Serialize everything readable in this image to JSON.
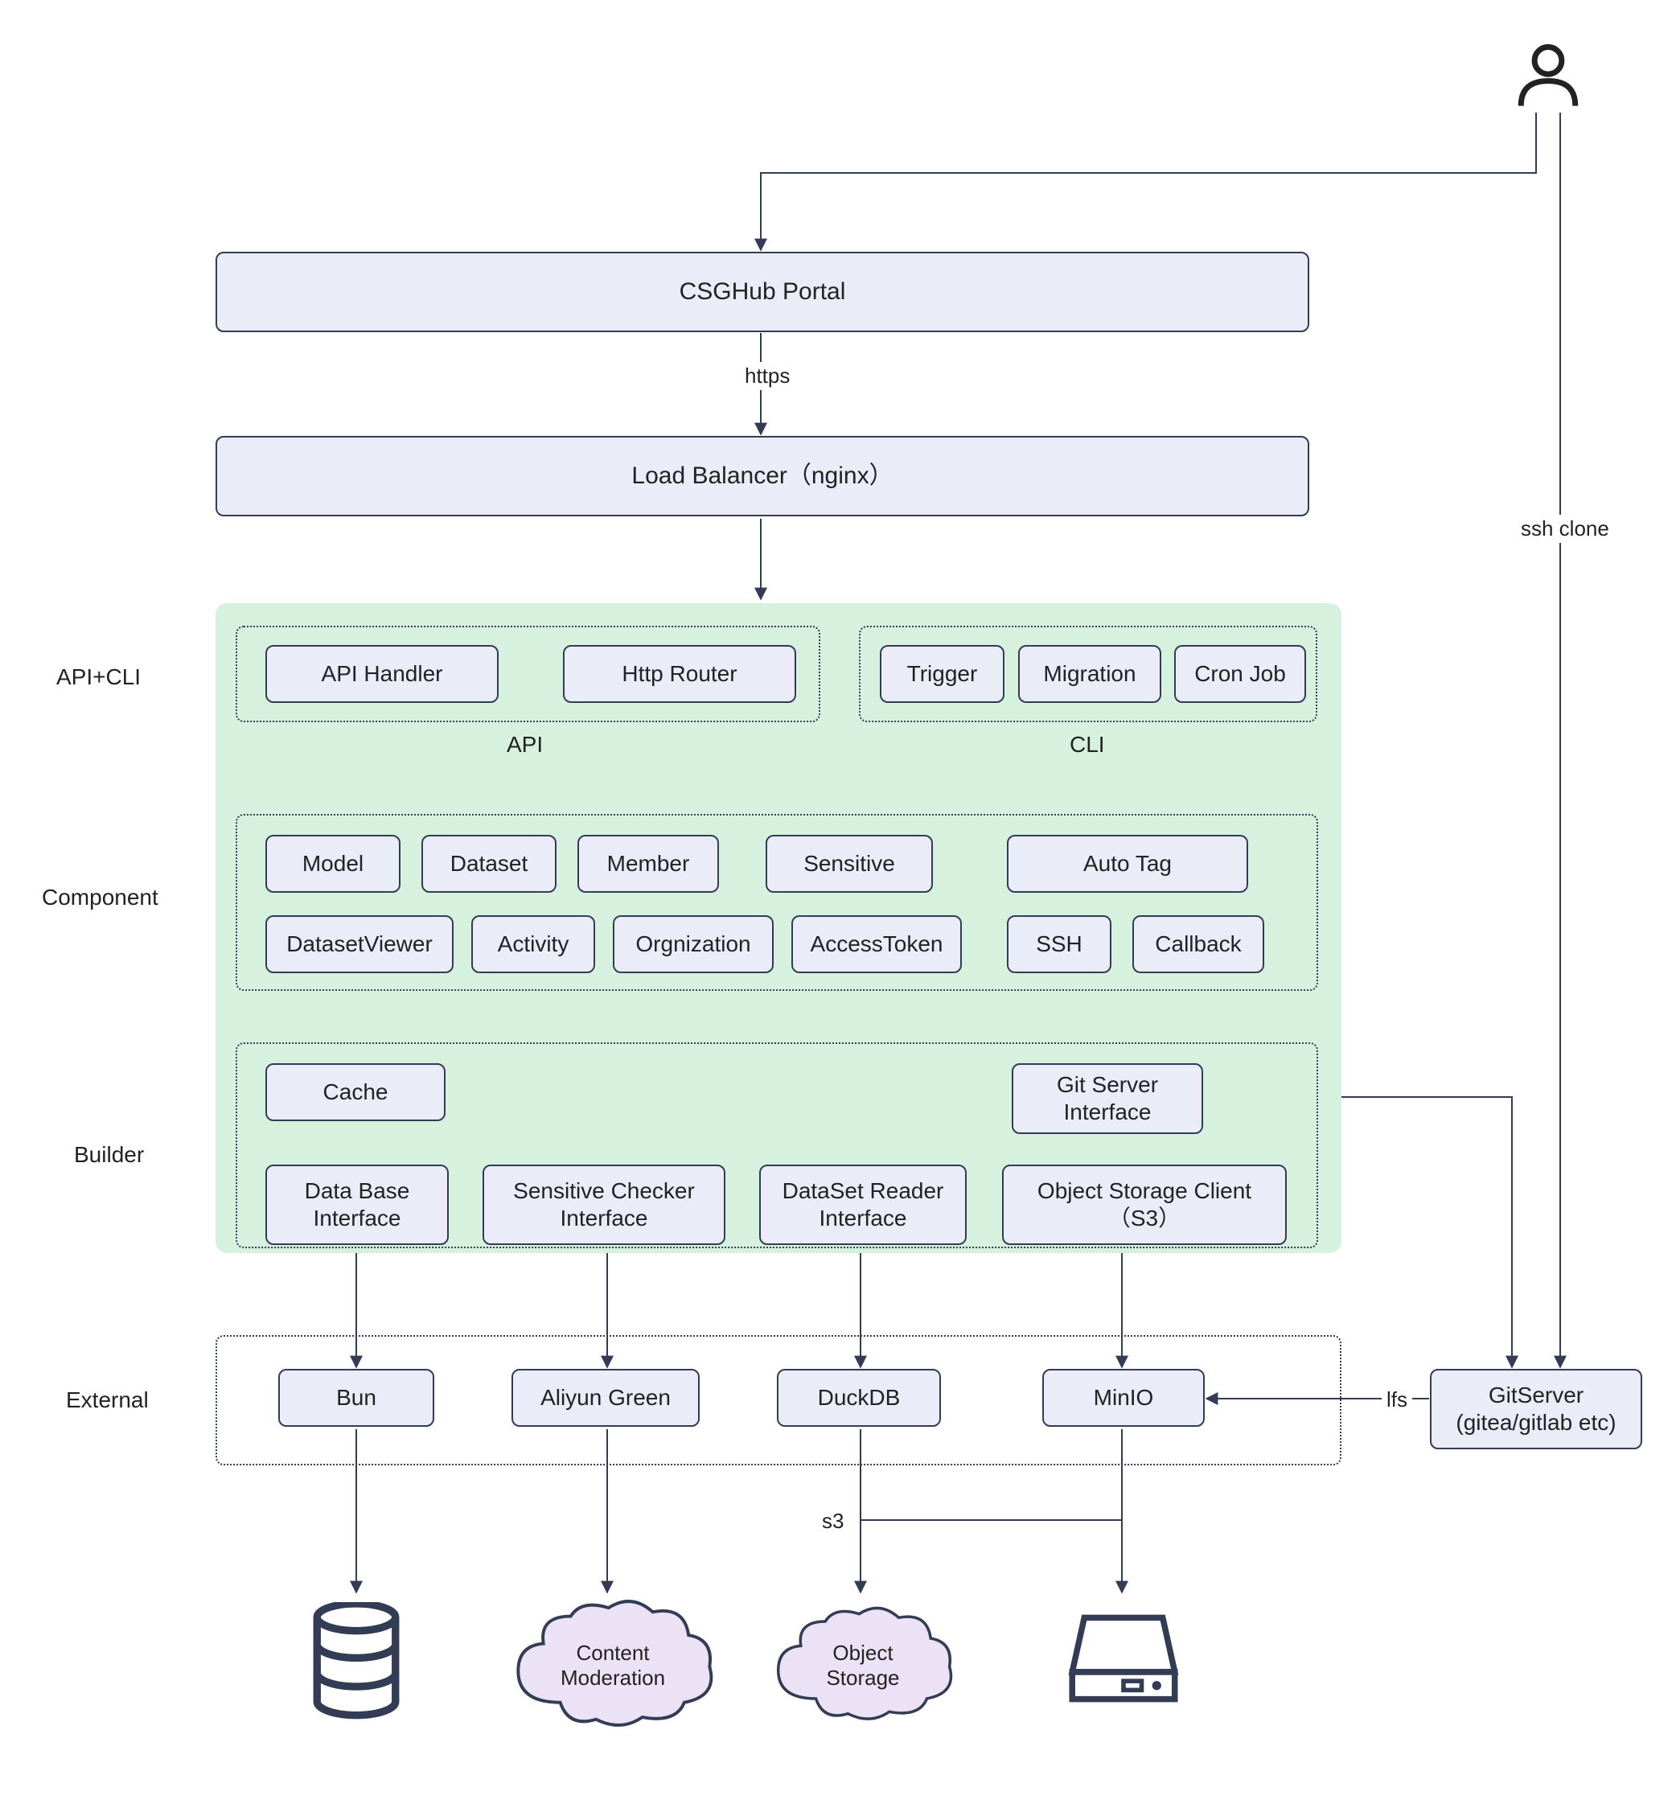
{
  "top": {
    "portal": "CSGHub Portal",
    "loadBalancer": "Load Balancer（nginx）",
    "https": "https",
    "sshClone": "ssh clone"
  },
  "rowLabels": {
    "apiCli": "API+CLI",
    "component": "Component",
    "builder": "Builder",
    "external": "External"
  },
  "apiCli": {
    "apiHandler": "API Handler",
    "httpRouter": "Http Router",
    "trigger": "Trigger",
    "migration": "Migration",
    "cronJob": "Cron Job",
    "apiCaption": "API",
    "cliCaption": "CLI"
  },
  "component": {
    "model": "Model",
    "dataset": "Dataset",
    "member": "Member",
    "sensitive": "Sensitive",
    "autoTag": "Auto Tag",
    "datasetViewer": "DatasetViewer",
    "activity": "Activity",
    "orgnization": "Orgnization",
    "accessToken": "AccessToken",
    "ssh": "SSH",
    "callback": "Callback"
  },
  "builder": {
    "cache": "Cache",
    "gitServerInterface": "Git Server\nInterface",
    "dbInterface": "Data Base\nInterface",
    "sensitiveChecker": "Sensitive Checker\nInterface",
    "datasetReader": "DataSet Reader\nInterface",
    "objectStorageClient": "Object Storage Client\n（S3）"
  },
  "external": {
    "bun": "Bun",
    "aliyunGreen": "Aliyun Green",
    "duckdb": "DuckDB",
    "minio": "MinIO",
    "gitserver": "GitServer\n(gitea/gitlab etc)",
    "lfs": "lfs",
    "s3": "s3"
  },
  "clouds": {
    "contentModeration": "Content\nModeration",
    "objectStorage": "Object\nStorage"
  }
}
